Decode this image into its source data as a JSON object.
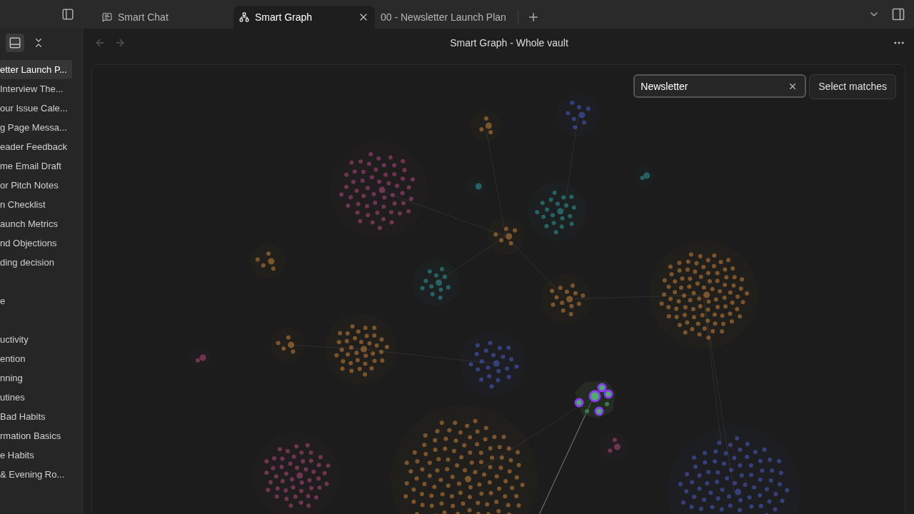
{
  "tabs": [
    {
      "label": "Smart Chat",
      "kind": "chat",
      "selected": false
    },
    {
      "label": "Smart Graph",
      "kind": "graph",
      "selected": true
    },
    {
      "label": "00 - Newsletter Launch Plan",
      "kind": "note",
      "selected": false
    }
  ],
  "sidebar": {
    "groups": [
      [
        {
          "label": "etter Launch P...",
          "selected": true
        },
        {
          "label": "Interview The...",
          "selected": false
        },
        {
          "label": "our Issue Cale...",
          "selected": false
        },
        {
          "label": "g Page Messa...",
          "selected": false
        },
        {
          "label": "eader Feedback",
          "selected": false
        },
        {
          "label": "me Email Draft",
          "selected": false
        },
        {
          "label": "or Pitch Notes",
          "selected": false
        },
        {
          "label": "n Checklist",
          "selected": false
        },
        {
          "label": "aunch Metrics",
          "selected": false
        },
        {
          "label": "nd Objections",
          "selected": false
        },
        {
          "label": "ding decision",
          "selected": false
        }
      ],
      [
        {
          "label": "e",
          "selected": false
        }
      ],
      [
        {
          "label": "uctivity",
          "selected": false
        },
        {
          "label": "ention",
          "selected": false
        },
        {
          "label": "nning",
          "selected": false
        },
        {
          "label": "utines",
          "selected": false
        },
        {
          "label": "Bad Habits",
          "selected": false
        },
        {
          "label": "rmation Basics",
          "selected": false
        },
        {
          "label": "e Habits",
          "selected": false
        },
        {
          "label": "& Evening Ro...",
          "selected": false
        }
      ]
    ]
  },
  "view": {
    "title": "Smart Graph - Whole vault"
  },
  "search": {
    "value": "Newsletter",
    "button": "Select matches"
  }
}
